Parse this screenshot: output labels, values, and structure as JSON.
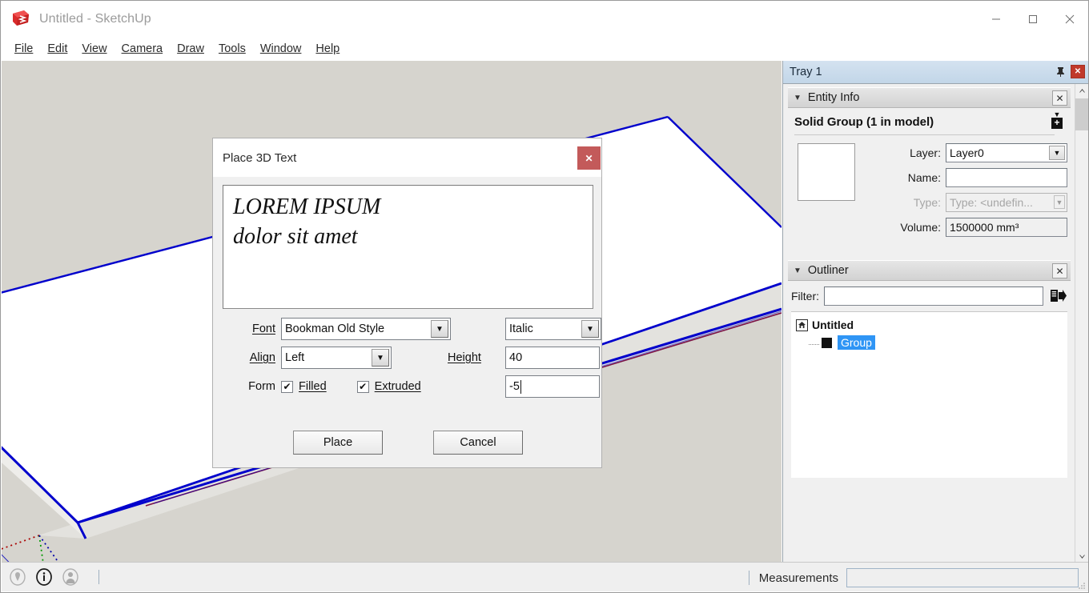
{
  "window": {
    "title": "Untitled - SketchUp",
    "logo_icon": "sketchup-logo-icon",
    "minimize_label": "—",
    "maximize_label": "☐",
    "close_label": "✕"
  },
  "menubar": {
    "items": [
      {
        "label": "File",
        "mnemonic": "F"
      },
      {
        "label": "Edit",
        "mnemonic": "E"
      },
      {
        "label": "View",
        "mnemonic": "V"
      },
      {
        "label": "Camera",
        "mnemonic": "C"
      },
      {
        "label": "Draw",
        "mnemonic": "r"
      },
      {
        "label": "Tools",
        "mnemonic": "T"
      },
      {
        "label": "Window",
        "mnemonic": "W"
      },
      {
        "label": "Help",
        "mnemonic": "H"
      }
    ]
  },
  "viewport": {
    "background_color": "#d6d4ce",
    "face_color": "#ffffff",
    "selected_edge_color": "#0000cc",
    "axis_red_color": "#aa0000",
    "axis_green_color": "#009900",
    "axis_blue_color": "#0000aa",
    "side_face_color": "#e3e2de",
    "bottom_edge_color": "#7a1144"
  },
  "tray": {
    "title": "Tray 1",
    "pin_icon": "pin-icon",
    "close_icon": "close-icon",
    "close_label": "✕",
    "scrollbar": {
      "up_label": "⌃",
      "down_label": "⌄"
    },
    "entity_info": {
      "caret": "▼",
      "title": "Entity Info",
      "close_label": "✕",
      "heading": "Solid Group (1 in model)",
      "expander_triangle": "▼",
      "expander_plus": "+",
      "thumbnail_icon": "solid-group-thumbnail",
      "fields": [
        {
          "label": "Layer:",
          "value": "Layer0",
          "type": "combo",
          "dim": false
        },
        {
          "label": "Name:",
          "value": "",
          "type": "text",
          "dim": false
        },
        {
          "label": "Type:",
          "value": "Type: <undefin...",
          "type": "combo-small",
          "dim": true
        },
        {
          "label": "Volume:",
          "value": "1500000 mm³",
          "type": "readonly",
          "dim": false
        }
      ]
    },
    "outliner": {
      "caret": "▼",
      "title": "Outliner",
      "close_label": "✕",
      "filter_label": "Filter:",
      "filter_value": "",
      "filter_placeholder": "",
      "export_icon": "export-arrow-icon",
      "tree": [
        {
          "label": "Untitled",
          "icon": "home-icon",
          "level": 0,
          "selected": false
        },
        {
          "label": "Group",
          "icon": "group-square-icon",
          "level": 1,
          "selected": true
        }
      ],
      "selection_color": "#2f95f5"
    }
  },
  "statusbar": {
    "icons": [
      {
        "name": "geo-location-icon",
        "active": false
      },
      {
        "name": "info-circle-icon",
        "active": true
      },
      {
        "name": "user-avatar-icon",
        "active": false
      }
    ],
    "measurements_label": "Measurements",
    "measurements_value": "",
    "measurements_placeholder": ""
  },
  "dialog": {
    "title": "Place 3D Text",
    "close_label": "✕",
    "close_icon": "close-icon",
    "text_value": "LOREM IPSUM\ndolor sit amet",
    "fields": {
      "font_label": "Font",
      "font_mnemonic": "F",
      "font_value": "Bookman Old Style",
      "style_value": "Italic",
      "align_label": "Align",
      "align_mnemonic": "A",
      "align_value": "Left",
      "height_label": "Height",
      "height_mnemonic": "H",
      "height_value": "40",
      "extrude_value": "-5",
      "form_label": "Form",
      "filled_label": "Filled",
      "filled_checked": "✔",
      "extruded_label": "Extruded",
      "extruded_checked": "✔",
      "dropdown_arrow": "▼"
    },
    "buttons": {
      "place_label": "Place",
      "cancel_label": "Cancel"
    }
  }
}
